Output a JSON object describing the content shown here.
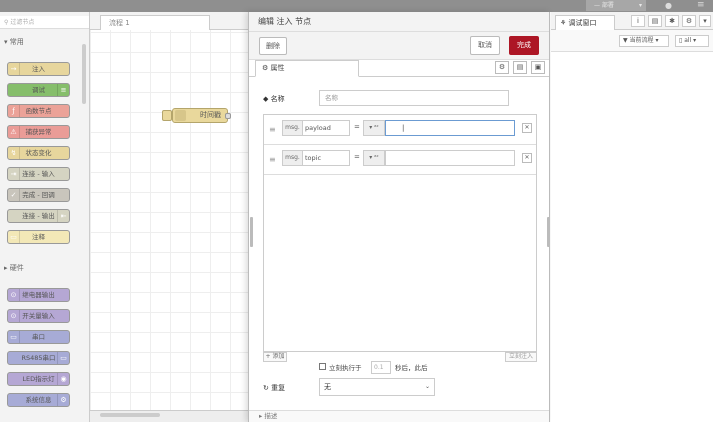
{
  "topbar": {
    "deploy_label": "—  部署",
    "user_icon": "user-icon",
    "menu_icon": "hamburger-icon"
  },
  "palette": {
    "search_placeholder": "过滤节点",
    "categories": [
      {
        "label": "▾ 常用"
      },
      {
        "label": "▸ 硬件"
      }
    ],
    "common_nodes": [
      {
        "label": "注入",
        "color": "#e7d69d"
      },
      {
        "label": "调试",
        "color": "#86be6b"
      },
      {
        "label": "函数节点",
        "color": "#eba298"
      },
      {
        "label": "捕获异常",
        "color": "#ea9c97"
      },
      {
        "label": "状态变化",
        "color": "#e7d69d"
      },
      {
        "label": "连接 - 输入",
        "color": "#d5d4c2"
      },
      {
        "label": "完成 - 回调",
        "color": "#c9c5bc"
      },
      {
        "label": "连接 - 输出",
        "color": "#d5d4c2"
      },
      {
        "label": "注释",
        "color": "#f3e8b7"
      }
    ],
    "hardware_nodes": [
      {
        "label": "继电器输出",
        "color": "#b5a7d4"
      },
      {
        "label": "开关量输入",
        "color": "#b5a7d4"
      },
      {
        "label": "串口",
        "color": "#a7abd6"
      },
      {
        "label": "RS485串口",
        "color": "#a7abd6"
      },
      {
        "label": "LED指示灯",
        "color": "#b5a7d4"
      },
      {
        "label": "系统信息",
        "color": "#a7abd6"
      }
    ]
  },
  "workspace": {
    "flow_tab": "流程 1",
    "node_label": "时间戳"
  },
  "tray": {
    "title": "编辑 注入 节点",
    "delete_label": "删除",
    "cancel_label": "取消",
    "done_label": "完成",
    "tab_properties": "⚙ 属性",
    "name_label": "◆ 名称",
    "name_placeholder": "名称",
    "rows": [
      {
        "prefix": "msg.",
        "prop": "payload",
        "type": "▾ ᵃᶻ",
        "value": "|"
      },
      {
        "prefix": "msg.",
        "prop": "topic",
        "type": "▾ ᵃᶻ",
        "value": ""
      }
    ],
    "add_label": "+ 添加",
    "inject_now_label": "立刻注入",
    "once_label": "立刻执行于",
    "once_value": "0.1",
    "once_suffix": "秒后，此后",
    "repeat_label": "↻ 重复",
    "repeat_value": "无",
    "bottom_label": "▸ 描述"
  },
  "sidebar": {
    "tab_label": "调试窗口",
    "filter_node": "当前流程",
    "filter_all": "all"
  }
}
